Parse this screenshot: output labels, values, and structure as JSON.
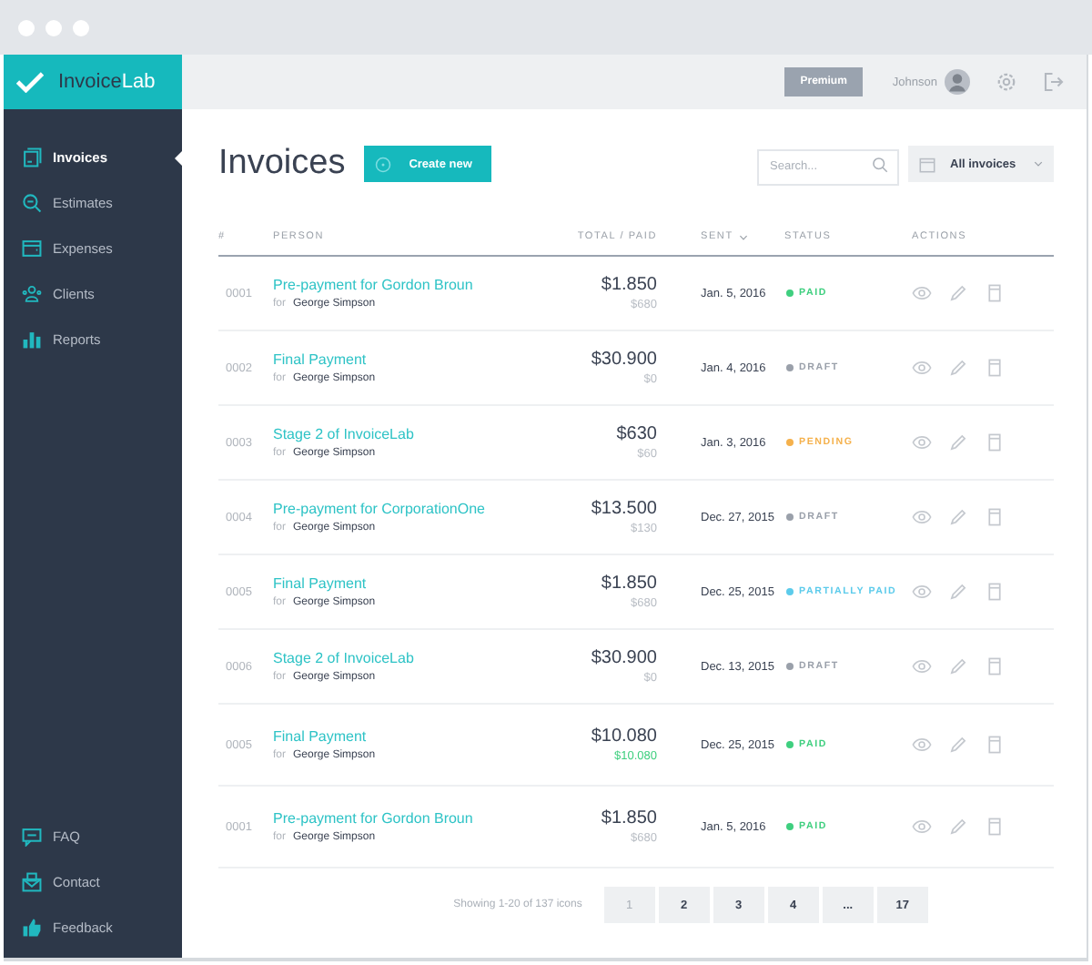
{
  "brand": {
    "name": "Invoice",
    "accent": "Lab"
  },
  "sidebar": {
    "items": [
      {
        "label": "Invoices",
        "selected": true
      },
      {
        "label": "Estimates",
        "selected": false
      },
      {
        "label": "Expenses",
        "selected": false
      },
      {
        "label": "Clients",
        "selected": false
      },
      {
        "label": "Reports",
        "selected": false
      }
    ],
    "footer_items": [
      {
        "label": "FAQ"
      },
      {
        "label": "Contact"
      },
      {
        "label": "Feedback"
      }
    ]
  },
  "header": {
    "badge": "Premium",
    "user": "Johnson"
  },
  "page": {
    "title": "Invoices",
    "create_button": "Create new"
  },
  "search": {
    "placeholder": "Search..."
  },
  "filter": {
    "label": "All invoices"
  },
  "table": {
    "columns": [
      "#",
      "PERSON",
      "TOTAL / PAID",
      "SENT",
      "STATUS",
      "ACTIONS"
    ],
    "rows": [
      {
        "number": "0001",
        "title": "Pre-payment for Gordon Broun",
        "for": "for",
        "client": "George Simpson",
        "total": "$1.850",
        "paid": "$680",
        "settled": false,
        "sent": "Jan. 5, 2016",
        "status": "PAID",
        "color": "#3fcf7f"
      },
      {
        "number": "0002",
        "title": "Final Payment",
        "for": "for",
        "client": "George Simpson",
        "total": "$30.900",
        "paid": "$0",
        "settled": false,
        "sent": "Jan. 4, 2016",
        "status": "DRAFT",
        "color": "#9aa0aa"
      },
      {
        "number": "0003",
        "title": "Stage 2 of InvoiceLab",
        "for": "for",
        "client": "George Simpson",
        "total": "$630",
        "paid": "$60",
        "settled": false,
        "sent": "Jan. 3, 2016",
        "status": "PENDING",
        "color": "#f5b14c"
      },
      {
        "number": "0004",
        "title": "Pre-payment for CorporationOne",
        "for": "for",
        "client": "George Simpson",
        "total": "$13.500",
        "paid": "$130",
        "settled": false,
        "sent": "Dec. 27, 2015",
        "status": "DRAFT",
        "color": "#9aa0aa"
      },
      {
        "number": "0005",
        "title": "Final Payment",
        "for": "for",
        "client": "George Simpson",
        "total": "$1.850",
        "paid": "$680",
        "settled": false,
        "sent": "Dec. 25, 2015",
        "status": "PARTIALLY PAID",
        "color": "#5ccbeb"
      },
      {
        "number": "0006",
        "title": "Stage 2 of InvoiceLab",
        "for": "for",
        "client": "George Simpson",
        "total": "$30.900",
        "paid": "$0",
        "settled": false,
        "sent": "Dec. 13, 2015",
        "status": "DRAFT",
        "color": "#9aa0aa"
      },
      {
        "number": "0005",
        "title": "Final Payment",
        "for": "for",
        "client": "George Simpson",
        "total": "$10.080",
        "paid": "$10.080",
        "settled": true,
        "sent": "Dec. 25, 2015",
        "status": "PAID",
        "color": "#3fcf7f"
      },
      {
        "number": "0001",
        "title": "Pre-payment for Gordon Broun",
        "for": "for",
        "client": "George Simpson",
        "total": "$1.850",
        "paid": "$680",
        "settled": false,
        "sent": "Jan. 5, 2016",
        "status": "PAID",
        "color": "#3fcf7f"
      }
    ]
  },
  "pagination": {
    "summary": "Showing 1-20 of 137 icons",
    "pages": [
      {
        "label": "1",
        "selected": true
      },
      {
        "label": "2",
        "selected": false
      },
      {
        "label": "3",
        "selected": false
      },
      {
        "label": "4",
        "selected": false
      },
      {
        "label": "...",
        "selected": false
      },
      {
        "label": "17",
        "selected": false
      }
    ]
  }
}
